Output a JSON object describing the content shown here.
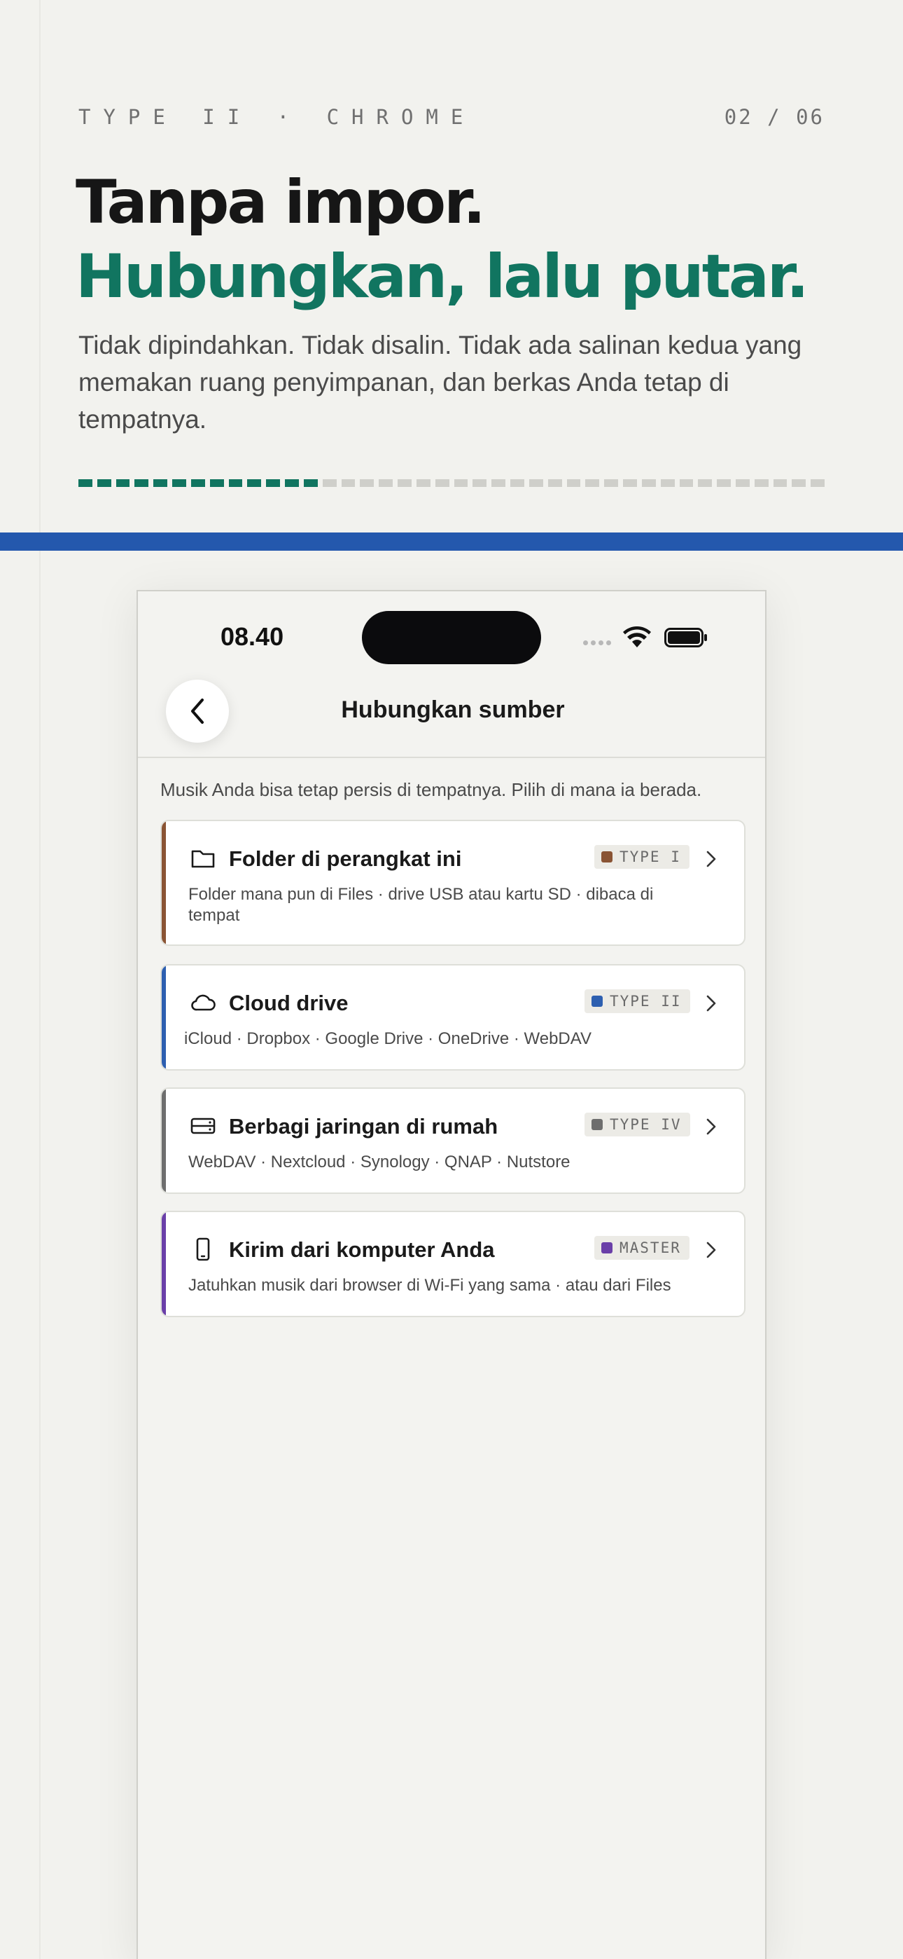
{
  "header": {
    "kicker": "TYPE II · CHROME",
    "pager": "02 / 06",
    "headline_1": "Tanpa impor.",
    "headline_2": "Hubungkan, lalu putar.",
    "lede": "Tidak dipindahkan. Tidak disalin. Tidak ada salinan kedua yang memakan ruang penyimpanan, dan berkas Anda tetap di tempatnya.",
    "progress": {
      "total_segments": 40,
      "filled_segments": 13
    }
  },
  "colors": {
    "accent_green": "#117560",
    "rule_blue": "#2458ad",
    "type_i": "#8a5434",
    "type_ii": "#2d5fb0",
    "type_iv": "#6e6e6e",
    "master": "#6a3fa8"
  },
  "phone": {
    "status": {
      "time": "08.40"
    },
    "nav": {
      "title": "Hubungkan sumber",
      "back_icon": "chevron-left-icon"
    },
    "intro": "Musik Anda bisa tetap persis di tempatnya. Pilih di mana ia berada.",
    "sources": [
      {
        "icon": "folder-icon",
        "title": "Folder di perangkat ini",
        "badge": "TYPE I",
        "desc": "Folder mana pun di Files · drive USB atau kartu SD · dibaca di tempat"
      },
      {
        "icon": "cloud-icon",
        "title": "Cloud drive",
        "badge": "TYPE II",
        "desc": "iCloud · Dropbox · Google Drive · OneDrive · WebDAV"
      },
      {
        "icon": "server-icon",
        "title": "Berbagi jaringan di rumah",
        "badge": "TYPE IV",
        "desc": "WebDAV · Nextcloud · Synology · QNAP · Nutstore"
      },
      {
        "icon": "phone-icon",
        "title": "Kirim dari komputer Anda",
        "badge": "MASTER",
        "desc": "Jatuhkan musik dari browser di Wi-Fi yang sama · atau dari Files"
      }
    ]
  }
}
